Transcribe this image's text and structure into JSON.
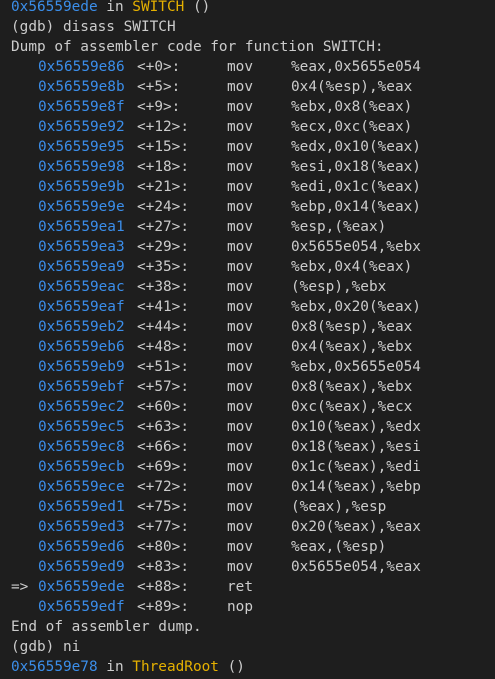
{
  "top_line": {
    "addr": "0x56559ede",
    "in": " in ",
    "func": "SWITCH",
    "tail": " ()"
  },
  "cmd1": "(gdb) disass SWITCH",
  "dump_header": "Dump of assembler code for function SWITCH:",
  "instructions": [
    {
      "marker": "",
      "addr": "0x56559e86",
      "off": "<+0>:",
      "mnem": "mov",
      "ops": "%eax,0x5655e054"
    },
    {
      "marker": "",
      "addr": "0x56559e8b",
      "off": "<+5>:",
      "mnem": "mov",
      "ops": "0x4(%esp),%eax"
    },
    {
      "marker": "",
      "addr": "0x56559e8f",
      "off": "<+9>:",
      "mnem": "mov",
      "ops": "%ebx,0x8(%eax)"
    },
    {
      "marker": "",
      "addr": "0x56559e92",
      "off": "<+12>:",
      "mnem": "mov",
      "ops": "%ecx,0xc(%eax)"
    },
    {
      "marker": "",
      "addr": "0x56559e95",
      "off": "<+15>:",
      "mnem": "mov",
      "ops": "%edx,0x10(%eax)"
    },
    {
      "marker": "",
      "addr": "0x56559e98",
      "off": "<+18>:",
      "mnem": "mov",
      "ops": "%esi,0x18(%eax)"
    },
    {
      "marker": "",
      "addr": "0x56559e9b",
      "off": "<+21>:",
      "mnem": "mov",
      "ops": "%edi,0x1c(%eax)"
    },
    {
      "marker": "",
      "addr": "0x56559e9e",
      "off": "<+24>:",
      "mnem": "mov",
      "ops": "%ebp,0x14(%eax)"
    },
    {
      "marker": "",
      "addr": "0x56559ea1",
      "off": "<+27>:",
      "mnem": "mov",
      "ops": "%esp,(%eax)"
    },
    {
      "marker": "",
      "addr": "0x56559ea3",
      "off": "<+29>:",
      "mnem": "mov",
      "ops": "0x5655e054,%ebx"
    },
    {
      "marker": "",
      "addr": "0x56559ea9",
      "off": "<+35>:",
      "mnem": "mov",
      "ops": "%ebx,0x4(%eax)"
    },
    {
      "marker": "",
      "addr": "0x56559eac",
      "off": "<+38>:",
      "mnem": "mov",
      "ops": "(%esp),%ebx"
    },
    {
      "marker": "",
      "addr": "0x56559eaf",
      "off": "<+41>:",
      "mnem": "mov",
      "ops": "%ebx,0x20(%eax)"
    },
    {
      "marker": "",
      "addr": "0x56559eb2",
      "off": "<+44>:",
      "mnem": "mov",
      "ops": "0x8(%esp),%eax"
    },
    {
      "marker": "",
      "addr": "0x56559eb6",
      "off": "<+48>:",
      "mnem": "mov",
      "ops": "0x4(%eax),%ebx"
    },
    {
      "marker": "",
      "addr": "0x56559eb9",
      "off": "<+51>:",
      "mnem": "mov",
      "ops": "%ebx,0x5655e054"
    },
    {
      "marker": "",
      "addr": "0x56559ebf",
      "off": "<+57>:",
      "mnem": "mov",
      "ops": "0x8(%eax),%ebx"
    },
    {
      "marker": "",
      "addr": "0x56559ec2",
      "off": "<+60>:",
      "mnem": "mov",
      "ops": "0xc(%eax),%ecx"
    },
    {
      "marker": "",
      "addr": "0x56559ec5",
      "off": "<+63>:",
      "mnem": "mov",
      "ops": "0x10(%eax),%edx"
    },
    {
      "marker": "",
      "addr": "0x56559ec8",
      "off": "<+66>:",
      "mnem": "mov",
      "ops": "0x18(%eax),%esi"
    },
    {
      "marker": "",
      "addr": "0x56559ecb",
      "off": "<+69>:",
      "mnem": "mov",
      "ops": "0x1c(%eax),%edi"
    },
    {
      "marker": "",
      "addr": "0x56559ece",
      "off": "<+72>:",
      "mnem": "mov",
      "ops": "0x14(%eax),%ebp"
    },
    {
      "marker": "",
      "addr": "0x56559ed1",
      "off": "<+75>:",
      "mnem": "mov",
      "ops": "(%eax),%esp"
    },
    {
      "marker": "",
      "addr": "0x56559ed3",
      "off": "<+77>:",
      "mnem": "mov",
      "ops": "0x20(%eax),%eax"
    },
    {
      "marker": "",
      "addr": "0x56559ed6",
      "off": "<+80>:",
      "mnem": "mov",
      "ops": "%eax,(%esp)"
    },
    {
      "marker": "",
      "addr": "0x56559ed9",
      "off": "<+83>:",
      "mnem": "mov",
      "ops": "0x5655e054,%eax"
    },
    {
      "marker": "=>",
      "addr": "0x56559ede",
      "off": "<+88>:",
      "mnem": "ret",
      "ops": ""
    },
    {
      "marker": "",
      "addr": "0x56559edf",
      "off": "<+89>:",
      "mnem": "nop",
      "ops": ""
    }
  ],
  "dump_footer": "End of assembler dump.",
  "cmd2": "(gdb) ni",
  "bottom_line": {
    "addr": "0x56559e78",
    "in": " in ",
    "func": "ThreadRoot",
    "tail": " ()"
  },
  "colors": {
    "background": "#1e1e1e",
    "text": "#cccccc",
    "address": "#3b8eea",
    "function": "#e5b000"
  }
}
